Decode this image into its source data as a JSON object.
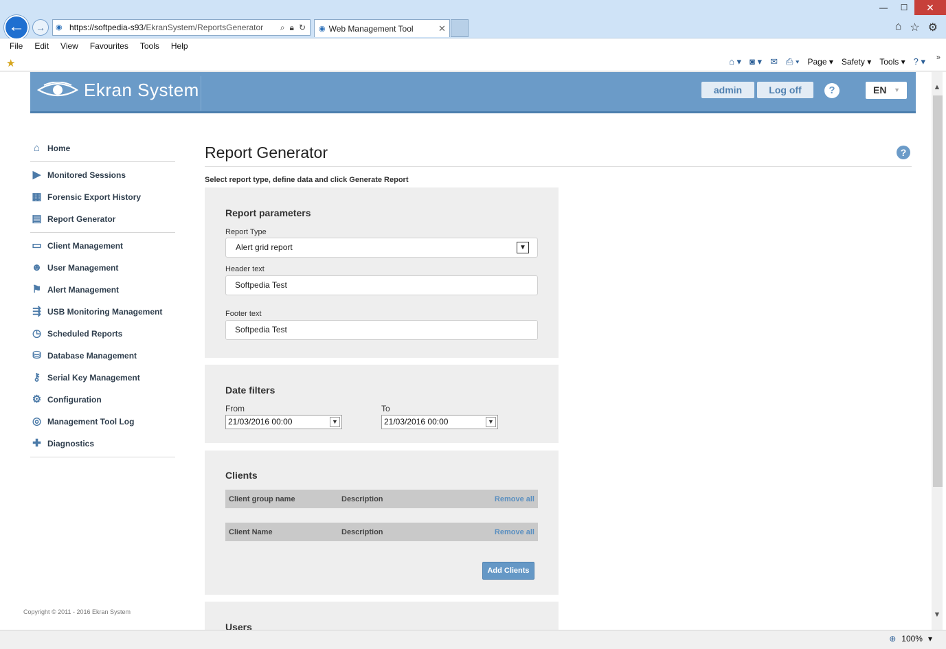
{
  "browser": {
    "url_main": "https://softpedia-s93",
    "url_rest": "/EkranSystem/ReportsGenerator",
    "tab_title": "Web Management Tool",
    "menu": [
      "File",
      "Edit",
      "View",
      "Favourites",
      "Tools",
      "Help"
    ],
    "cmd": {
      "page": "Page",
      "safety": "Safety",
      "tools": "Tools"
    },
    "zoom": "100%"
  },
  "header": {
    "brand": "Ekran System",
    "user": "admin",
    "logoff": "Log off",
    "help": "?",
    "lang": "EN"
  },
  "sidebar": {
    "groups": [
      [
        {
          "label": "Home",
          "icon": "home-icon"
        }
      ],
      [
        {
          "label": "Monitored Sessions",
          "icon": "monitor-play-icon"
        },
        {
          "label": "Forensic Export History",
          "icon": "film-icon"
        },
        {
          "label": "Report Generator",
          "icon": "report-icon"
        }
      ],
      [
        {
          "label": "Client Management",
          "icon": "computer-icon"
        },
        {
          "label": "User Management",
          "icon": "users-icon"
        },
        {
          "label": "Alert Management",
          "icon": "alert-icon"
        },
        {
          "label": "USB Monitoring Management",
          "icon": "usb-icon"
        },
        {
          "label": "Scheduled Reports",
          "icon": "clock-report-icon"
        },
        {
          "label": "Database Management",
          "icon": "database-icon"
        },
        {
          "label": "Serial Key Management",
          "icon": "key-icon"
        },
        {
          "label": "Configuration",
          "icon": "gear-icon"
        },
        {
          "label": "Management Tool Log",
          "icon": "log-icon"
        },
        {
          "label": "Diagnostics",
          "icon": "diagnostics-icon"
        }
      ]
    ],
    "copyright": "Copyright © 2011 - 2016 Ekran System"
  },
  "main": {
    "title": "Report Generator",
    "subtitle": "Select report type, define data and click Generate Report",
    "report_params": {
      "title": "Report parameters",
      "report_type_label": "Report Type",
      "report_type_value": "Alert grid report",
      "header_label": "Header text",
      "header_value": "Softpedia Test",
      "footer_label": "Footer text",
      "footer_value": "Softpedia Test"
    },
    "date_filters": {
      "title": "Date filters",
      "from_label": "From",
      "from_value": "21/03/2016 00:00",
      "to_label": "To",
      "to_value": "21/03/2016 00:00"
    },
    "clients": {
      "title": "Clients",
      "group_table": {
        "col1": "Client group name",
        "col2": "Description",
        "remove": "Remove all"
      },
      "client_table": {
        "col1": "Client Name",
        "col2": "Description",
        "remove": "Remove all"
      },
      "add_button": "Add Clients"
    },
    "users": {
      "title": "Users"
    }
  }
}
